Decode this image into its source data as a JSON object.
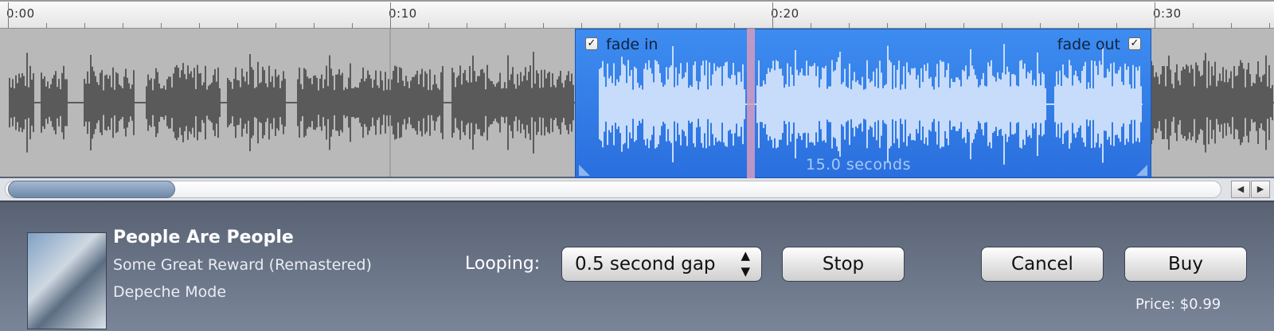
{
  "ruler": {
    "labels": [
      "0:00",
      "0:10",
      "0:20",
      "0:30"
    ]
  },
  "selection": {
    "fade_in_label": "fade in",
    "fade_in_checked": true,
    "fade_out_label": "fade out",
    "fade_out_checked": true,
    "duration_text": "15.0 seconds"
  },
  "song": {
    "title": "People Are People",
    "album": "Some Great Reward (Remastered)",
    "artist": "Depeche Mode"
  },
  "controls": {
    "looping_label": "Looping:",
    "looping_value": "0.5 second gap",
    "stop_label": "Stop",
    "cancel_label": "Cancel",
    "buy_label": "Buy",
    "price_text": "Price: $0.99"
  },
  "colors": {
    "selection_blue": "#2f7be8",
    "waveform_gray": "#5a5a5a",
    "waveform_selected": "#c7dcfb",
    "playhead": "#d69cc0"
  },
  "icons": [
    "checkbox-checked-icon",
    "resize-corner-icon",
    "scroll-left-icon",
    "scroll-right-icon",
    "select-arrows-icon"
  ]
}
